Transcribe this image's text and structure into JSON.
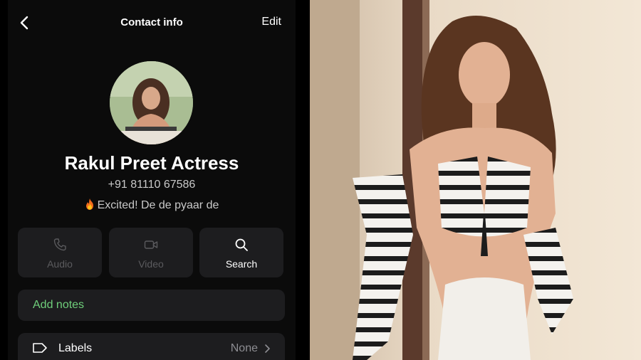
{
  "header": {
    "title": "Contact info",
    "edit_label": "Edit"
  },
  "profile": {
    "name": "Rakul Preet Actress",
    "phone": "+91 81110 67586",
    "status_text": "Excited! De de pyaar de"
  },
  "actions": [
    {
      "label": "Audio",
      "icon": "phone-icon",
      "enabled": false
    },
    {
      "label": "Video",
      "icon": "video-icon",
      "enabled": false
    },
    {
      "label": "Search",
      "icon": "search-icon",
      "enabled": true
    }
  ],
  "notes": {
    "label": "Add notes"
  },
  "labels_row": {
    "label": "Labels",
    "value": "None"
  },
  "colors": {
    "accent_green": "#6fcf7b",
    "panel": "#1d1d1f",
    "background": "#0b0b0b"
  }
}
